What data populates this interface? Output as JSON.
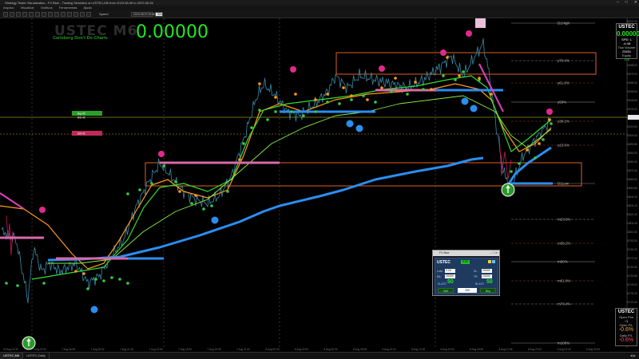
{
  "window": {
    "title": "Strategy Tester Visualization - FX Blue - Trading Simulator on USTEC,M6 from 2023.08.06 to 2023.08.26",
    "minimize_icon": "minimize-icon",
    "maximize_icon": "maximize-icon",
    "close_icon": "close-icon"
  },
  "menu": {
    "items": [
      "Arquivo",
      "Visualizar",
      "Gráficos",
      "Ferramentas",
      "Ajuda"
    ]
  },
  "toolbar": {
    "speed_label": "Speed",
    "date_label": "2023.08.07 00:00",
    "speed_value": "32x"
  },
  "overlay": {
    "symbol_watermark": "USTEC M6",
    "tagline": "Carlsberg Don't Do Charts",
    "price_display": "0.00000"
  },
  "panel_top": {
    "title": "USTEC",
    "value": "0.00000",
    "line1": "SPD: 1",
    "line2": "-4:48",
    "line3": "Tick Volume",
    "line4": "23451",
    "line5": "Equity",
    "line6": "178"
  },
  "panel_bottom": {
    "title": "USTEC",
    "line1": "Open Pos",
    "line2": "~1",
    "line3": "Open P/L",
    "line4": "-0.6%",
    "line5": "Daily P/L",
    "line6": "-0.6%"
  },
  "trade_panel": {
    "title": "FX Blue",
    "symbol": "USTEC",
    "price_badge": "0.00",
    "lots_label": "Lots:",
    "lots_value": "0.20",
    "sl_label": "SL:",
    "sl_value": "20000",
    "tp_label": "TP:",
    "tp_value": "20000",
    "slp_label": "S/L:",
    "sell_label": "SLAST",
    "sell_big": "50",
    "buy_label": "BLAST",
    "buy_big": "50",
    "sell_button": "Sell",
    "buy_button": "Buy",
    "qty": "100"
  },
  "fib_labels": [
    "D1High",
    "y76.4%",
    "y61.8%",
    "y50%",
    "y38.2%",
    "y23.6%",
    "D1Low",
    "m23.6%",
    "m38.2%",
    "m50%",
    "m61.8%",
    "m76.4%",
    "m100%"
  ],
  "level_tags": [
    "Buy #2",
    "B/S 40",
    "Sell 41"
  ],
  "chart_data": {
    "type": "line",
    "ylabel": "",
    "price_ticks": [
      "16037.00",
      "16027.20",
      "16017.40",
      "16007.60",
      "15997.80",
      "15988.00",
      "15978.20",
      "15968.40",
      "15958.60",
      "15948.80",
      "15939.00",
      "15929.20",
      "15919.40",
      "15909.60",
      "15899.80",
      "15890.00",
      "15880.20",
      "15870.40",
      "15860.60",
      "15850.80",
      "15841.00",
      "15831.20",
      "15821.40",
      "15811.60",
      "15801.80",
      "15792.00",
      "15782.20",
      "15772.40",
      "15762.60",
      "15752.80",
      "15743.00",
      "15733.20",
      "15723.40",
      "15713.60",
      "15703.80",
      "15694.00",
      "15684.20"
    ],
    "time_ticks": [
      "25 Aug 01:30",
      "7 Aug 03:30",
      "7 Aug 06:06",
      "7 Aug 08:42",
      "7 Aug 11:18",
      "7 Aug 13:54",
      "7 Aug 16:30",
      "7 Aug 19:06",
      "7 Aug 21:42",
      "8 Aug 00:18",
      "8 Aug 02:54",
      "8 Aug 05:30",
      "8 Aug 08:06",
      "8 Aug 10:42",
      "8 Aug 13:18",
      "8 Aug 15:54",
      "8 Aug 18:30",
      "8 Aug 21:06",
      "8 Aug 23:42",
      "9 Aug 02:18",
      "9 Aug 04:54"
    ],
    "colors": {
      "price": "#3a8aa8",
      "ma_fast": "#33dd33",
      "ma_mid": "#ff9a1a",
      "ma_slow": "#88ee44",
      "ma_long": "#2a8ef0",
      "zone": "#e06020"
    }
  }
}
